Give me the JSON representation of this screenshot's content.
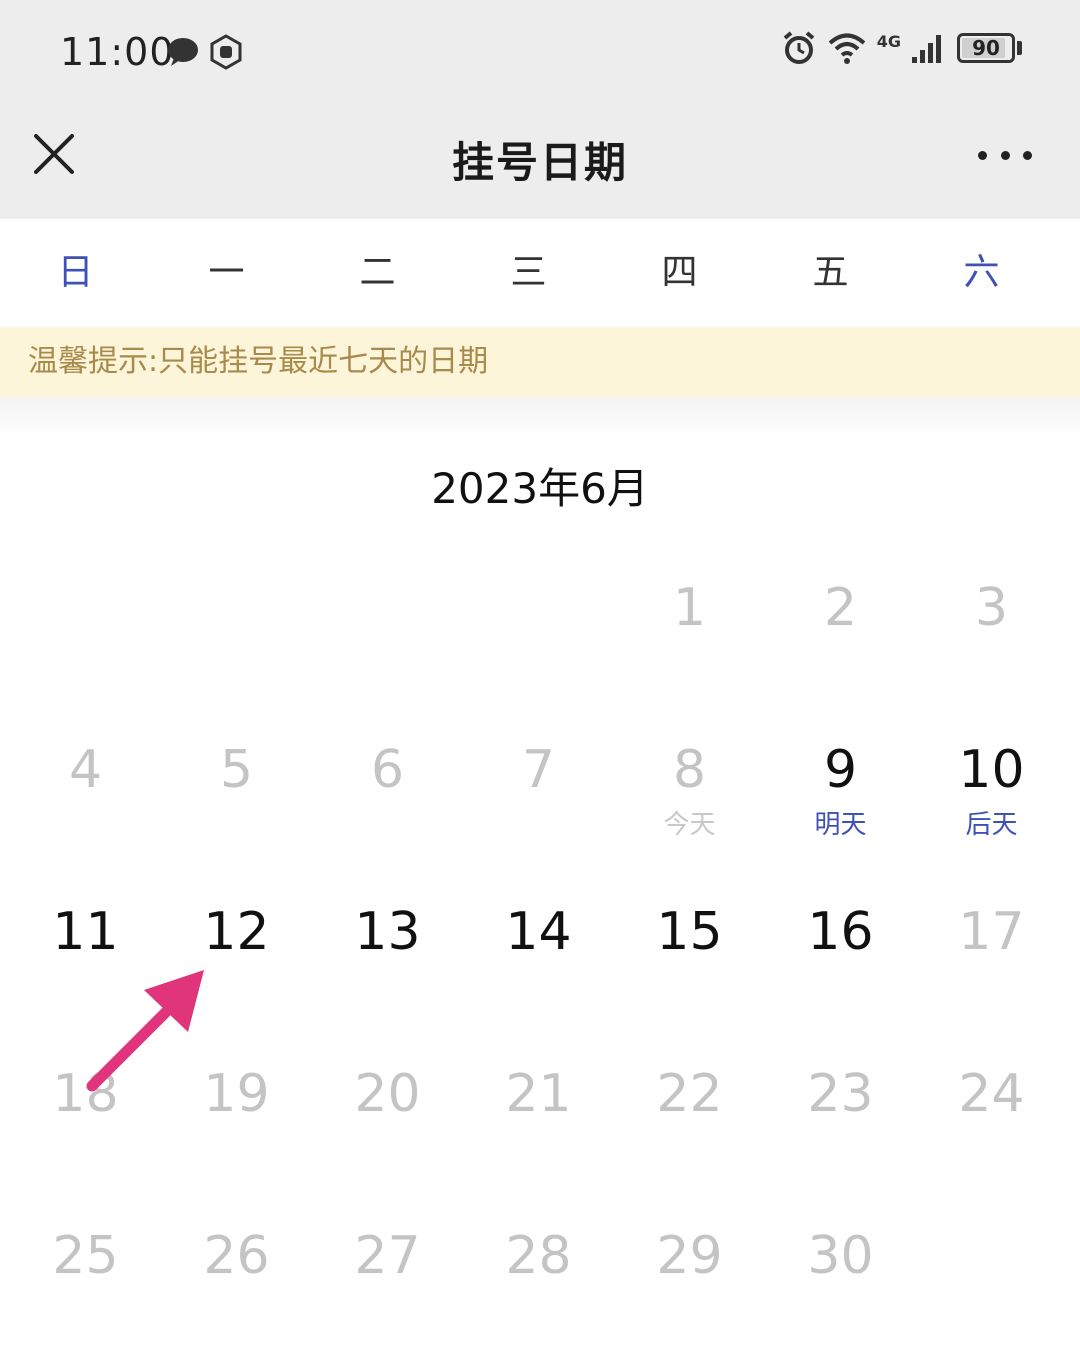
{
  "status_bar": {
    "time": "11:00",
    "network": "4G",
    "battery": "90",
    "battery_level_pct": 90
  },
  "nav": {
    "title": "挂号日期"
  },
  "weekdays": [
    "日",
    "一",
    "二",
    "三",
    "四",
    "五",
    "六"
  ],
  "tip": "温馨提示:只能挂号最近七天的日期",
  "month_title": "2023年6月",
  "calendar": {
    "rows": [
      [
        {
          "num": "",
          "state": "empty",
          "sub": ""
        },
        {
          "num": "",
          "state": "empty",
          "sub": ""
        },
        {
          "num": "",
          "state": "empty",
          "sub": ""
        },
        {
          "num": "",
          "state": "empty",
          "sub": ""
        },
        {
          "num": "1",
          "state": "disabled",
          "sub": ""
        },
        {
          "num": "2",
          "state": "disabled",
          "sub": ""
        },
        {
          "num": "3",
          "state": "disabled",
          "sub": ""
        }
      ],
      [
        {
          "num": "4",
          "state": "disabled",
          "sub": ""
        },
        {
          "num": "5",
          "state": "disabled",
          "sub": ""
        },
        {
          "num": "6",
          "state": "disabled",
          "sub": ""
        },
        {
          "num": "7",
          "state": "disabled",
          "sub": ""
        },
        {
          "num": "8",
          "state": "disabled",
          "sub": "今天"
        },
        {
          "num": "9",
          "state": "enabled",
          "sub": "明天"
        },
        {
          "num": "10",
          "state": "enabled",
          "sub": "后天"
        }
      ],
      [
        {
          "num": "11",
          "state": "enabled",
          "sub": ""
        },
        {
          "num": "12",
          "state": "enabled",
          "sub": ""
        },
        {
          "num": "13",
          "state": "enabled",
          "sub": ""
        },
        {
          "num": "14",
          "state": "enabled",
          "sub": ""
        },
        {
          "num": "15",
          "state": "enabled",
          "sub": ""
        },
        {
          "num": "16",
          "state": "enabled",
          "sub": ""
        },
        {
          "num": "17",
          "state": "disabled",
          "sub": ""
        }
      ],
      [
        {
          "num": "18",
          "state": "disabled",
          "sub": ""
        },
        {
          "num": "19",
          "state": "disabled",
          "sub": ""
        },
        {
          "num": "20",
          "state": "disabled",
          "sub": ""
        },
        {
          "num": "21",
          "state": "disabled",
          "sub": ""
        },
        {
          "num": "22",
          "state": "disabled",
          "sub": ""
        },
        {
          "num": "23",
          "state": "disabled",
          "sub": ""
        },
        {
          "num": "24",
          "state": "disabled",
          "sub": ""
        }
      ],
      [
        {
          "num": "25",
          "state": "disabled",
          "sub": ""
        },
        {
          "num": "26",
          "state": "disabled",
          "sub": ""
        },
        {
          "num": "27",
          "state": "disabled",
          "sub": ""
        },
        {
          "num": "28",
          "state": "disabled",
          "sub": ""
        },
        {
          "num": "29",
          "state": "disabled",
          "sub": ""
        },
        {
          "num": "30",
          "state": "disabled",
          "sub": ""
        },
        {
          "num": "",
          "state": "empty",
          "sub": ""
        }
      ]
    ]
  },
  "icons": {
    "close": "close-icon",
    "more": "more-icon",
    "annotation": "arrow-annotation-icon"
  },
  "colors": {
    "accent": "#3f51b5",
    "disabled": "#c4c4c4",
    "tip_bg": "#fdf5d9",
    "tip_text": "#a88a4a",
    "annotation": "#e0357a"
  }
}
